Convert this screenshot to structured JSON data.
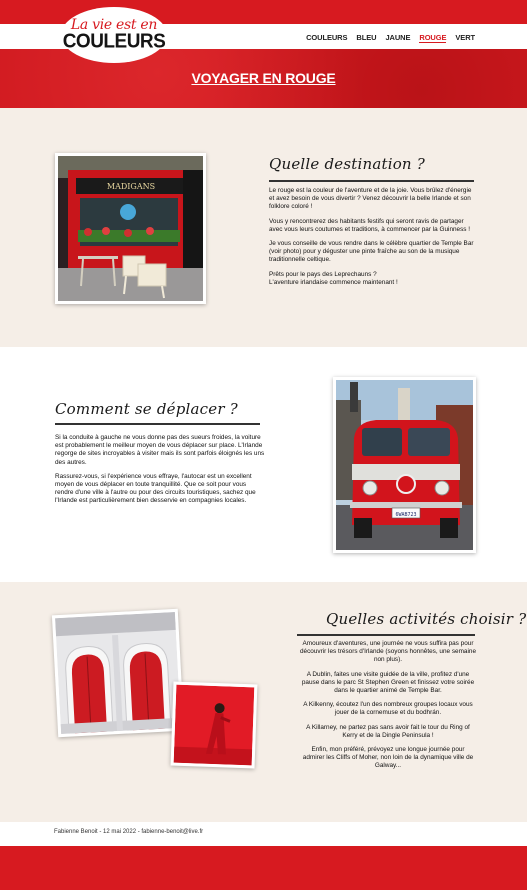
{
  "header": {
    "logo_script": "La vie est en",
    "logo_main": "COULEURS",
    "nav": [
      {
        "label": "COULEURS",
        "active": false
      },
      {
        "label": "BLEU",
        "active": false
      },
      {
        "label": "JAUNE",
        "active": false
      },
      {
        "label": "ROUGE",
        "active": true
      },
      {
        "label": "VERT",
        "active": false
      }
    ]
  },
  "hero": {
    "title": "VOYAGER EN ROUGE"
  },
  "colors": {
    "brand_red": "#d71a20",
    "beige": "#f5eee7"
  },
  "sections": [
    {
      "title": "Quelle destination ?",
      "image_sign": "MADIGANS",
      "paragraphs": [
        "Le rouge est la couleur de l'aventure et de la joie. Vous brûlez d'énergie et avez besoin de vous divertir ? Venez découvrir la belle Irlande et son folklore coloré !",
        "Vous y rencontrerez des habitants festifs qui seront ravis de partager avec vous leurs coutumes et traditions, à commencer par la Guinness !",
        "Je vous conseille de vous rendre dans le célèbre quartier de Temple Bar (voir photo) pour y déguster une pinte fraîche au son de la musique traditionnelle celtique.",
        "Prêts pour le pays des Leprechauns ?\nL'aventure irlandaise commence maintenant !"
      ]
    },
    {
      "title": "Comment se déplacer ?",
      "image_plate": "6WAB723",
      "paragraphs": [
        "Si la conduite à gauche ne vous donne pas des sueurs froides, la voiture est probablement le meilleur moyen de vous déplacer sur place. L'Irlande regorge de sites incroyables à visiter mais ils sont parfois éloignés les uns des autres.",
        "Rassurez-vous, si l'expérience vous effraye, l'autocar est un excellent moyen de vous déplacer en toute tranquillité. Que ce soit pour vous rendre d'une ville à l'autre ou pour des circuits touristiques, sachez que l'Irlande est particulièrement bien desservie en compagnies locales."
      ]
    },
    {
      "title": "Quelles activités choisir ?",
      "paragraphs": [
        "Amoureux d'aventures, une journée ne vous suffira pas pour découvrir les trésors d'Irlande (soyons honnêtes, une semaine non plus).",
        "A Dublin, faites une visite guidée de la ville, profitez d'une pause dans le parc St Stephen Green et finissez votre soirée dans le quartier animé de Temple Bar.",
        "A Kilkenny, écoutez l'un des nombreux groupes locaux vous jouer de la cornemuse et du bodhrán.",
        "A Killarney, ne partez pas sans avoir fait le tour du Ring of Kerry et de la Dingle Peninsula !",
        "Enfin, mon préféré, prévoyez une longue journée pour admirer les Cliffs of Moher, non loin de la dynamique ville de Galway..."
      ]
    }
  ],
  "footer": {
    "text": "Fabienne Benoit - 12 mai 2022 - fabienne-benoit@live.fr"
  }
}
